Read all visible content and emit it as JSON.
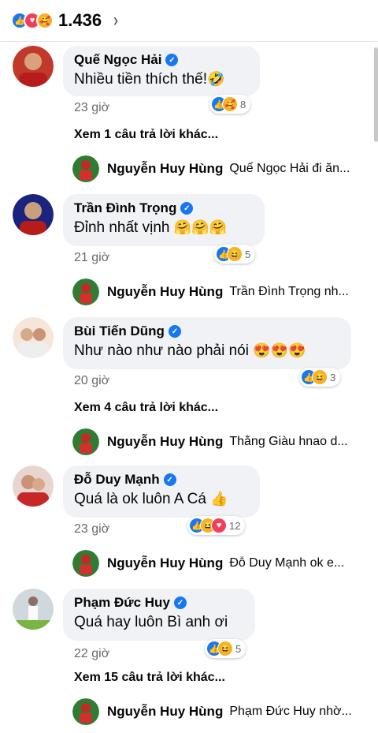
{
  "header": {
    "reaction_icons": [
      "like-icon",
      "love-icon",
      "care-icon"
    ],
    "total_reactions": "1.436",
    "chevron": "›"
  },
  "comments": [
    {
      "author": "Quế Ngọc Hải",
      "text": "Nhiều tiền thích thế!",
      "emoji": "🤣",
      "time": "23 giờ",
      "reaction_count": "8",
      "reaction_icons": [
        "like-icon",
        "care-icon"
      ],
      "more_replies": "Xem 1 câu trả lời khác...",
      "reply": {
        "author": "Nguyễn Huy Hùng",
        "text": "Quế Ngọc Hải  đi ăn..."
      }
    },
    {
      "author": "Trần Đình Trọng",
      "text": "Đỉnh nhất vịnh",
      "emoji": "🤗🤗🤗",
      "time": "21 giờ",
      "reaction_count": "5",
      "reaction_icons": [
        "like-icon",
        "haha-icon"
      ],
      "more_replies": "",
      "reply": {
        "author": "Nguyễn Huy Hùng",
        "text": "Trần Đình Trọng nh..."
      }
    },
    {
      "author": "Bùi Tiến Dũng",
      "text": "Như nào như nào phải nói",
      "emoji": "😍😍😍",
      "time": "20 giờ",
      "reaction_count": "3",
      "reaction_icons": [
        "like-icon",
        "haha-icon"
      ],
      "more_replies": "Xem 4 câu trả lời khác...",
      "reply": {
        "author": "Nguyễn Huy Hùng",
        "text": "Thằng Giàu hnao d..."
      }
    },
    {
      "author": "Đỗ Duy Mạnh",
      "text": "Quá là ok luôn A Cá",
      "emoji": "👍",
      "time": "23 giờ",
      "reaction_count": "12",
      "reaction_icons": [
        "like-icon",
        "haha-icon",
        "love-icon"
      ],
      "more_replies": "",
      "reply": {
        "author": "Nguyễn Huy Hùng",
        "text": "Đỗ Duy Mạnh  ok e..."
      }
    },
    {
      "author": "Phạm Đức Huy",
      "text": "Quá hay luôn Bì anh ơi",
      "emoji": "",
      "time": "22 giờ",
      "reaction_count": "5",
      "reaction_icons": [
        "like-icon",
        "haha-icon"
      ],
      "more_replies": "Xem 15 câu trả lời khác...",
      "reply": {
        "author": "Nguyễn Huy Hùng",
        "text": "Phạm Đức Huy  nhờ..."
      }
    }
  ]
}
